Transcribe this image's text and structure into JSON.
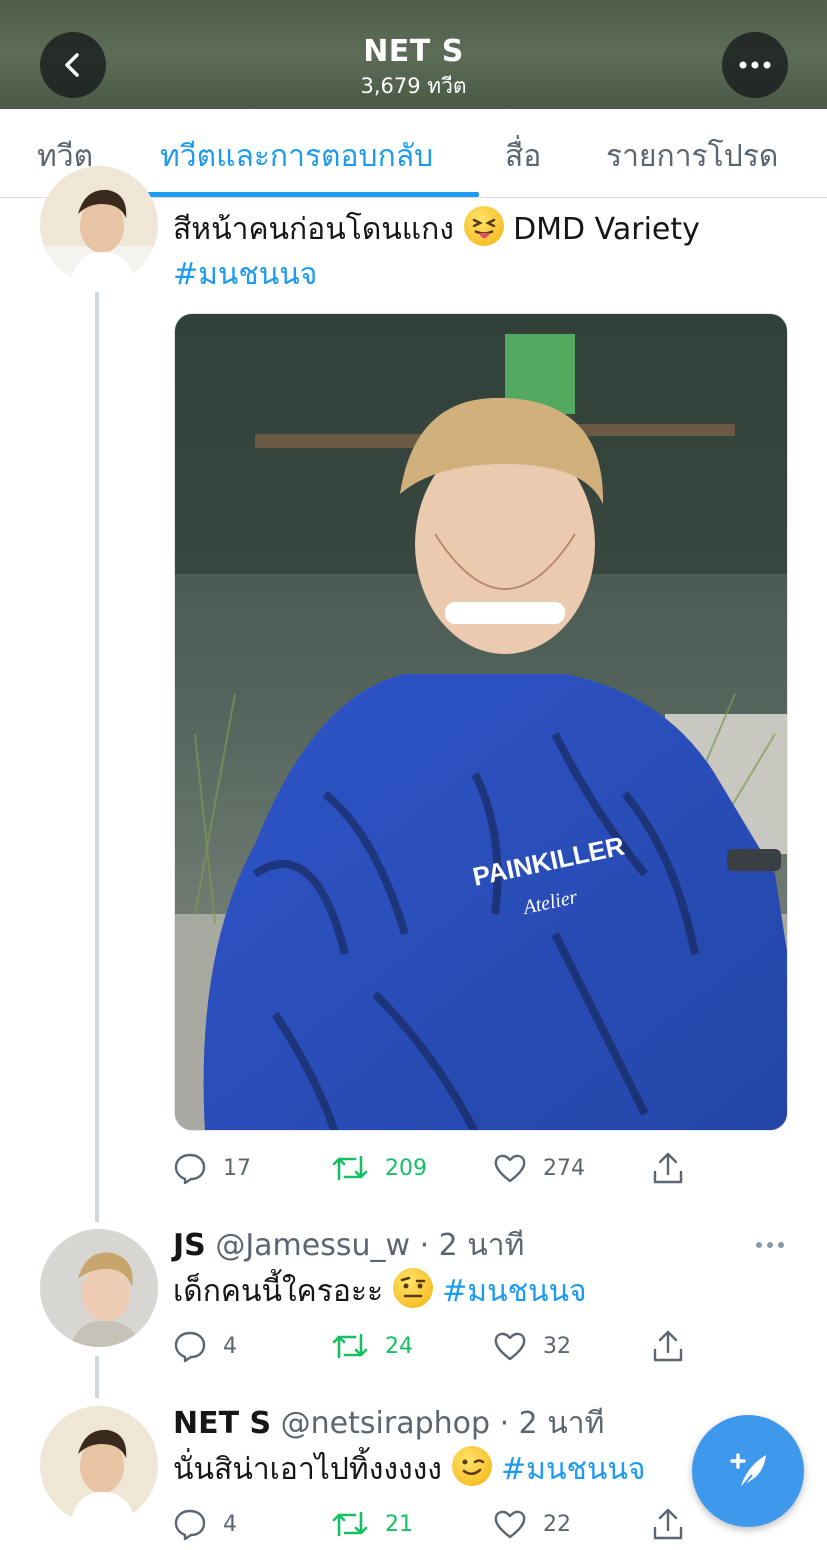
{
  "header": {
    "title": "NET S",
    "subtitle": "3,679 ทวีต"
  },
  "tabs": [
    {
      "label": "ทวีต"
    },
    {
      "label": "ทวีตและการตอบกลับ"
    },
    {
      "label": "สื่อ"
    },
    {
      "label": "รายการโปรด"
    }
  ],
  "active_tab": "ทวีตและการตอบกลับ",
  "main_tweet": {
    "text_line1": "สีหน้าคนก่อนโดนแกง",
    "text_line1_suffix": "DMD Variety",
    "hashtag": "#มนชนนจ",
    "media_shirt_text": "PAINKILLER",
    "media_shirt_sub": "Atelier",
    "replies": "17",
    "retweets": "209",
    "likes": "274"
  },
  "reply1": {
    "name": "JS",
    "handle": "@Jamessu_w · 2 นาที",
    "text": "เด็กคนนี้ใครอะะ",
    "hashtag": "#มนชนนจ",
    "replies": "4",
    "retweets": "24",
    "likes": "32"
  },
  "reply2": {
    "name": "NET S",
    "handle": "@netsiraphop · 2 นาที",
    "text": "นั่นสิน่าเอาไปทิ้งงงงง",
    "hashtag": "#มนชนนจ",
    "replies": "4",
    "retweets": "21",
    "likes": "22"
  },
  "colors": {
    "accent": "#1d9bf0",
    "retweet": "#17bf63",
    "fab": "#3e99ec"
  },
  "icons": [
    "chevron-left-icon",
    "more-icon",
    "reply-icon",
    "retweet-icon",
    "like-icon",
    "share-icon",
    "compose-icon"
  ]
}
